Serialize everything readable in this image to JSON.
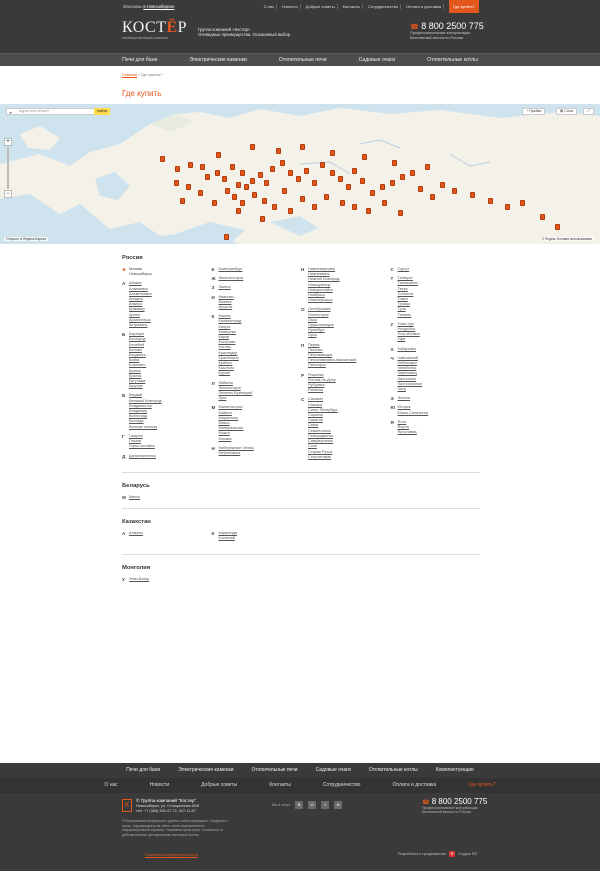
{
  "topbar": {
    "shops_prefix": "Магазины",
    "shops_city": "в Новосибирске",
    "links": [
      "О нас",
      "Новости",
      "Добрые советы",
      "Контакты",
      "Сотрудничество",
      "Оплата и доставка"
    ],
    "buy": "Где купить?"
  },
  "header": {
    "logo_word": "КОСТ",
    "logo_accent": "Ё",
    "logo_tail": "Р",
    "logo_sub": "ПРОИЗВОДСТВО ПЕЧЕЙ И КАМИНОВ",
    "group_line1": "Группа компаний «Костер»",
    "group_line2": "Очевидные преимущества. Осознанный выбор",
    "phone_num": "8 800 2500 775",
    "phone_prefix": "☎",
    "phone_note1": "Профессиональные консультации",
    "phone_note2": "Бесплатный звонок по России"
  },
  "nav": [
    "Печи для бани",
    "Электрические каменки",
    "Отопительные печи",
    "Садовые очаги",
    "Отопительные котлы"
  ],
  "breadcrumb": {
    "home": "Главная",
    "current": "Где купить?"
  },
  "page_title": "Где купить",
  "map": {
    "search_placeholder": "Адрес или объект",
    "find_button": "Найти",
    "traffic_label": "Пробки",
    "layers_label": "Слои",
    "fullscreen_icon": "expand-icon",
    "open_yandex": "Открыть в Яндекс.Картах",
    "copyright": "© Яндекс  Условия использования"
  },
  "russia": {
    "title": "Россия",
    "columns": [
      [
        {
          "letter": "★",
          "star": true,
          "items": [
            "Москва",
            "Новосибирск"
          ],
          "plain": true
        },
        {
          "letter": "А",
          "items": [
            "Абакан",
            "Алапаевск",
            "Альметьевск",
            "Ангарск",
            "Анжеро",
            "Армавир",
            "Артем",
            "Архангельск",
            "Астрахань"
          ]
        },
        {
          "letter": "Б",
          "items": [
            "Барнаул",
            "Белгород",
            "Белебей",
            "Белово",
            "Бердянск",
            "Бийск",
            "Благовеч.",
            "Братск",
            "Брянск",
            "Бугульма",
            "Бузулук"
          ]
        },
        {
          "letter": "В",
          "items": [
            "Вардай",
            "Великий Новгород",
            "Владивосток",
            "Владимир",
            "Волгоград",
            "Вологда",
            "Вятские поляны"
          ]
        },
        {
          "letter": "Г",
          "items": [
            "Гагарин",
            "Глазов",
            "Горно-Алтайск"
          ]
        },
        {
          "letter": "Д",
          "items": [
            "Дальнереченск"
          ]
        }
      ],
      [
        {
          "letter": "Е",
          "items": [
            "Екатеринбург"
          ]
        },
        {
          "letter": "Ж",
          "items": [
            "Железногорск"
          ]
        },
        {
          "letter": "З",
          "items": [
            "Заинск"
          ]
        },
        {
          "letter": "И",
          "items": [
            "Иваново",
            "Ижевск",
            "Иркутск"
          ]
        },
        {
          "letter": "К",
          "items": [
            "Казань",
            "Калининград",
            "Калуга",
            "Кемерово",
            "Киров",
            "Кострома",
            "Котлас",
            "Краснодар",
            "Красноярск",
            "Кузбасс",
            "Кыштым",
            "Курган"
          ]
        },
        {
          "letter": "Л",
          "items": [
            "Лабинск",
            "Лениногорск",
            "Ленинск-Кузнецкий",
            "Луга"
          ]
        },
        {
          "letter": "М",
          "items": [
            "Магнитогорск",
            "Майкоп",
            "Мариуполь",
            "Миасс",
            "Минеральные",
            "Можга",
            "Москва"
          ]
        },
        {
          "letter": "Н",
          "items": [
            "Набережные Челны",
            "Нефтекамск"
          ]
        }
      ],
      [
        {
          "letter": "Н",
          "items": [
            "Нижневартовск",
            "Нижнекамск",
            "Нижний Новгород",
            "Новокузнецк",
            "Новороссийск",
            "Ноябрьск",
            "Новочеркасск"
          ]
        },
        {
          "letter": "О",
          "items": [
            "Октябрьский",
            "Оленегорск",
            "Омск",
            "Орджоникидзе",
            "Оренбург",
            "Орск"
          ]
        },
        {
          "letter": "П",
          "items": [
            "Пермь",
            "Пестово",
            "Петрозаводск",
            "Петропавловск-Камчатский",
            "Пятигорск"
          ]
        },
        {
          "letter": "Р",
          "items": [
            "Рошинка",
            "Ростов-на-Дону",
            "Рубцовск",
            "Рыбинск"
          ]
        },
        {
          "letter": "С",
          "items": [
            "Салават",
            "Самара",
            "Санкт-Петербург",
            "Саранск",
            "Саратов",
            "Сатка",
            "Севастополь",
            "Северодвинск",
            "Симферополь",
            "Сочи",
            "Старая Русса",
            "Стерлитамак"
          ]
        }
      ],
      [
        {
          "letter": "С",
          "items": [
            "Сургут"
          ]
        },
        {
          "letter": "Т",
          "items": [
            "Таганрог",
            "Талнахинск",
            "Тверь",
            "Тольятти",
            "Томск",
            "Троицк",
            "Тула",
            "Тюмень"
          ]
        },
        {
          "letter": "У",
          "items": [
            "Улан-Удэ",
            "Уссурийск",
            "Усть-Илимск",
            "Уфа"
          ]
        },
        {
          "letter": "Х",
          "items": [
            "Хабаровск"
          ]
        },
        {
          "letter": "Ч",
          "items": [
            "Чайковский",
            "Чебоксары",
            "Челябинск",
            "Череповец",
            "Чистополь",
            "Чистоозерное",
            "Чита"
          ]
        },
        {
          "letter": "Э",
          "items": [
            "Элиста"
          ]
        },
        {
          "letter": "Ю",
          "items": [
            "Югорск",
            "Южно-Сахалинск"
          ]
        },
        {
          "letter": "Я",
          "items": [
            "Ялта",
            "Якутск",
            "Ярославль"
          ]
        }
      ]
    ]
  },
  "belarus": {
    "title": "Беларусь",
    "letter": "М",
    "items": [
      "Минск"
    ]
  },
  "kazakhstan": {
    "title": "Казахстан",
    "col1": {
      "letter": "А",
      "items": [
        "Алматы"
      ]
    },
    "col2": {
      "letter": "К",
      "items": [
        "Караганда",
        "Костанай"
      ]
    }
  },
  "mongolia": {
    "title": "Монголия",
    "letter": "У",
    "items": [
      "Улан-Батор"
    ]
  },
  "footer_nav": [
    "Печи для бани",
    "Электрические каменки",
    "Отопительные печи",
    "Садовые очаги",
    "Отопительные котлы",
    "Комплектующие"
  ],
  "footer_nav2": [
    "О нас",
    "Новости",
    "Добрые советы",
    "Контакты",
    "Сотрудничество",
    "Оплата и доставка",
    "Где купить?"
  ],
  "footer": {
    "logo_letter": "К",
    "group_title": "© Группа компаний \"Костер\"",
    "address1": "Новосибирск, ул. Станционная 60/8",
    "address2": "тел. +7 (383) 328-47-72, 347-11-67",
    "legal": "© Копирование материалов с данного сайта запрещено. Сведения о ценах, содержащиеся на сайте, носят исключительно информационный характер. Указанные цены могут отличаться от действительных цен магазинов-партнеров Костер.",
    "social_label": "Мы в сетях",
    "social": [
      "В",
      "О",
      "f",
      "И"
    ],
    "phone_num": "8 800 2500 775",
    "phone_prefix": "☎",
    "phone_note1": "Профессиональные консультации",
    "phone_note2": "Бесплатный звонок по России",
    "policy_link": "Политика конфиденциальности",
    "dev_label": "Разработка и продвижение",
    "dev_badge": "Я",
    "dev_name": "Студия ЯП"
  },
  "colors": {
    "accent": "#e2571b",
    "dark": "#3a3a3a",
    "map_water": "#cfe3ee",
    "map_land": "#f4f1e9"
  }
}
